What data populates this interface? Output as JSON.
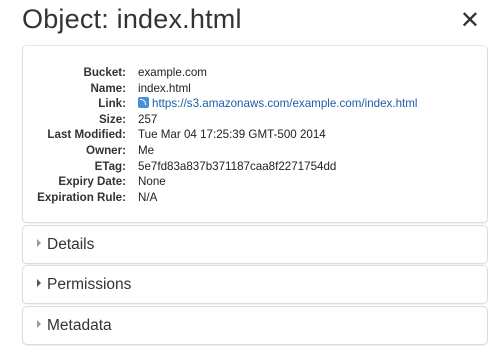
{
  "header": {
    "title": "Object: index.html",
    "close_symbol": "✕"
  },
  "properties": [
    {
      "key": "Bucket:",
      "value": "example.com"
    },
    {
      "key": "Name:",
      "value": "index.html"
    },
    {
      "key": "Link:",
      "value": "https://s3.amazonaws.com/example.com/index.html",
      "icon": "rss-feed-icon",
      "color": "#1a5da8"
    },
    {
      "key": "Size:",
      "value": "257"
    },
    {
      "key": "Last Modified:",
      "value": "Tue Mar 04 17:25:39 GMT-500 2014"
    },
    {
      "key": "Owner:",
      "value": "Me"
    },
    {
      "key": "ETag:",
      "value": "5e7fd83a837b371187caa8f2271754dd"
    },
    {
      "key": "Expiry Date:",
      "value": "None"
    },
    {
      "key": "Expiration Rule:",
      "value": "N/A"
    }
  ],
  "sections": [
    {
      "label": "Details"
    },
    {
      "label": "Permissions"
    },
    {
      "label": "Metadata"
    }
  ]
}
